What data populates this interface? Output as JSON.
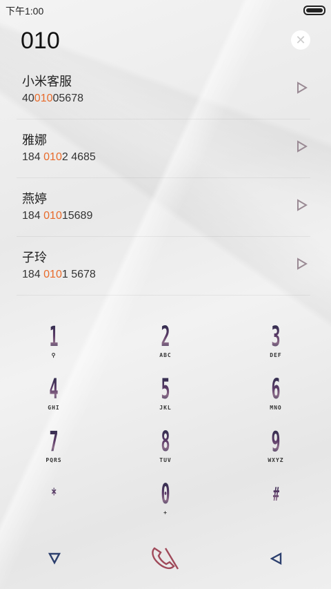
{
  "status": {
    "time": "下午1:00"
  },
  "search": {
    "query": "010",
    "clear_icon": "close-icon"
  },
  "results": [
    {
      "name": "小米客服",
      "pre": "40",
      "hl": "010",
      "post": "05678"
    },
    {
      "name": "雅娜",
      "pre": "184 ",
      "hl": "010",
      "post": "2 4685"
    },
    {
      "name": "燕婷",
      "pre": "184 ",
      "hl": "010",
      "post": "15689"
    },
    {
      "name": "子玲",
      "pre": "184 ",
      "hl": "010",
      "post": "1 5678"
    }
  ],
  "keypad": [
    {
      "digit": "1",
      "letters": "⚲"
    },
    {
      "digit": "2",
      "letters": "ABC"
    },
    {
      "digit": "3",
      "letters": "DEF"
    },
    {
      "digit": "4",
      "letters": "GHI"
    },
    {
      "digit": "5",
      "letters": "JKL"
    },
    {
      "digit": "6",
      "letters": "MNO"
    },
    {
      "digit": "7",
      "letters": "PQRS"
    },
    {
      "digit": "8",
      "letters": "TUV"
    },
    {
      "digit": "9",
      "letters": "WXYZ"
    },
    {
      "digit": "*",
      "letters": ""
    },
    {
      "digit": "0",
      "letters": "+"
    },
    {
      "digit": "#",
      "letters": ""
    }
  ],
  "colors": {
    "highlight": "#e86a2a",
    "call_accent": "#a04a5a"
  },
  "bottom": {
    "left_icon": "collapse-keypad-icon",
    "mid_icon": "call-icon",
    "right_icon": "backspace-icon"
  }
}
